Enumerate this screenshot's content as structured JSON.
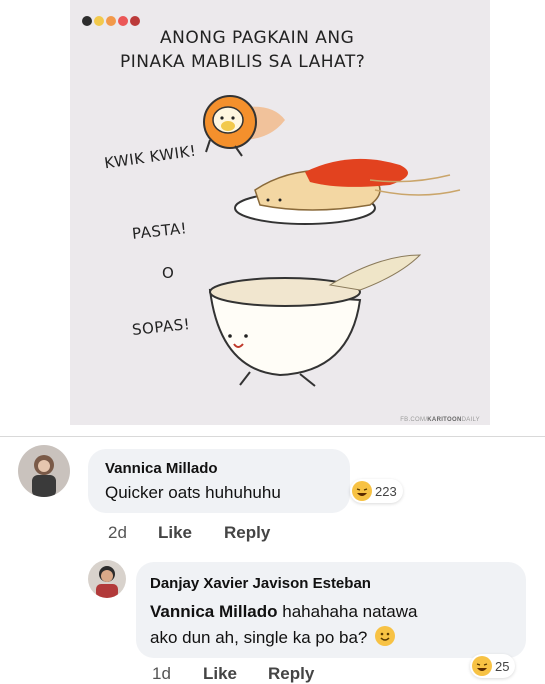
{
  "post": {
    "comic_title_line1": "ANONG PAGKAIN ANG",
    "comic_title_line2": "PINAKA MABILIS SA LAHAT?",
    "option1": "KWIK KWIK!",
    "option2": "PASTA!",
    "separator": "O",
    "option3": "SOPAS!",
    "watermark_prefix": "FB.COM/",
    "watermark_brand": "KARITOON",
    "watermark_suffix": "DAILY",
    "dot_colors": [
      "#2d2d2d",
      "#f2c94c",
      "#f2994a",
      "#eb5757",
      "#bb3a3a"
    ]
  },
  "comment": {
    "author": "Vannica Millado",
    "text": "Quicker oats huhuhuhu",
    "reaction_emoji": "laugh",
    "reaction_count": "223",
    "time": "2d",
    "like_label": "Like",
    "reply_label": "Reply"
  },
  "reply": {
    "author": "Danjay Xavier Javison Esteban",
    "mention": "Vannica Millado",
    "text_line1_rest": " hahahaha natawa",
    "text_line2": "ako dun ah, single ka po ba?",
    "inline_emoji": "smile",
    "reaction_emoji": "laugh",
    "reaction_count": "25",
    "time": "1d",
    "like_label": "Like",
    "reply_label": "Reply"
  }
}
